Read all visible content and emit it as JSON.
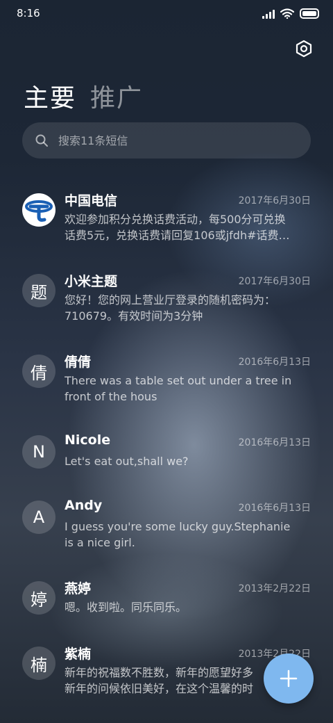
{
  "status_bar": {
    "time": "8:16"
  },
  "tabs": [
    {
      "label": "主要",
      "active": true
    },
    {
      "label": "推广",
      "active": false
    }
  ],
  "search": {
    "placeholder": "搜索11条短信"
  },
  "conversations": [
    {
      "avatar": "",
      "avatar_type": "china-telecom-logo",
      "name": "中国电信",
      "date": "2017年6月30日",
      "preview": "欢迎参加积分兑换话费活动，每500分可兑换\n话费5元，兑换话费请回复106或jfdh#话费…"
    },
    {
      "avatar": "题",
      "name": "小米主题",
      "date": "2017年6月30日",
      "preview": "您好！您的网上营业厅登录的随机密码为：\n710679。有效时间为3分钟"
    },
    {
      "avatar": "倩",
      "name": "倩倩",
      "date": "2016年6月13日",
      "preview": "There was a table set out under a tree in\nfront of the hous"
    },
    {
      "avatar": "N",
      "name": "Nicole",
      "date": "2016年6月13日",
      "preview": "Let's eat out,shall we?"
    },
    {
      "avatar": "A",
      "name": "Andy",
      "date": "2016年6月13日",
      "preview": "I guess you're some lucky guy.Stephanie\nis a nice girl."
    },
    {
      "avatar": "婷",
      "name": "燕婷",
      "date": "2013年2月22日",
      "preview": "嗯。收到啦。同乐同乐。"
    },
    {
      "avatar": "楠",
      "name": "紫楠",
      "date": "2013年2月22日",
      "preview": "新年的祝福数不胜数，新年的愿望好多\n新年的问候依旧美好，在这个温馨的时"
    }
  ],
  "icons": {
    "settings": "hexagon-settings-icon",
    "search": "search-icon",
    "compose": "plus-icon"
  },
  "colors": {
    "fab": "#7fb8ef",
    "telecom_blue": "#1a5fb4"
  }
}
